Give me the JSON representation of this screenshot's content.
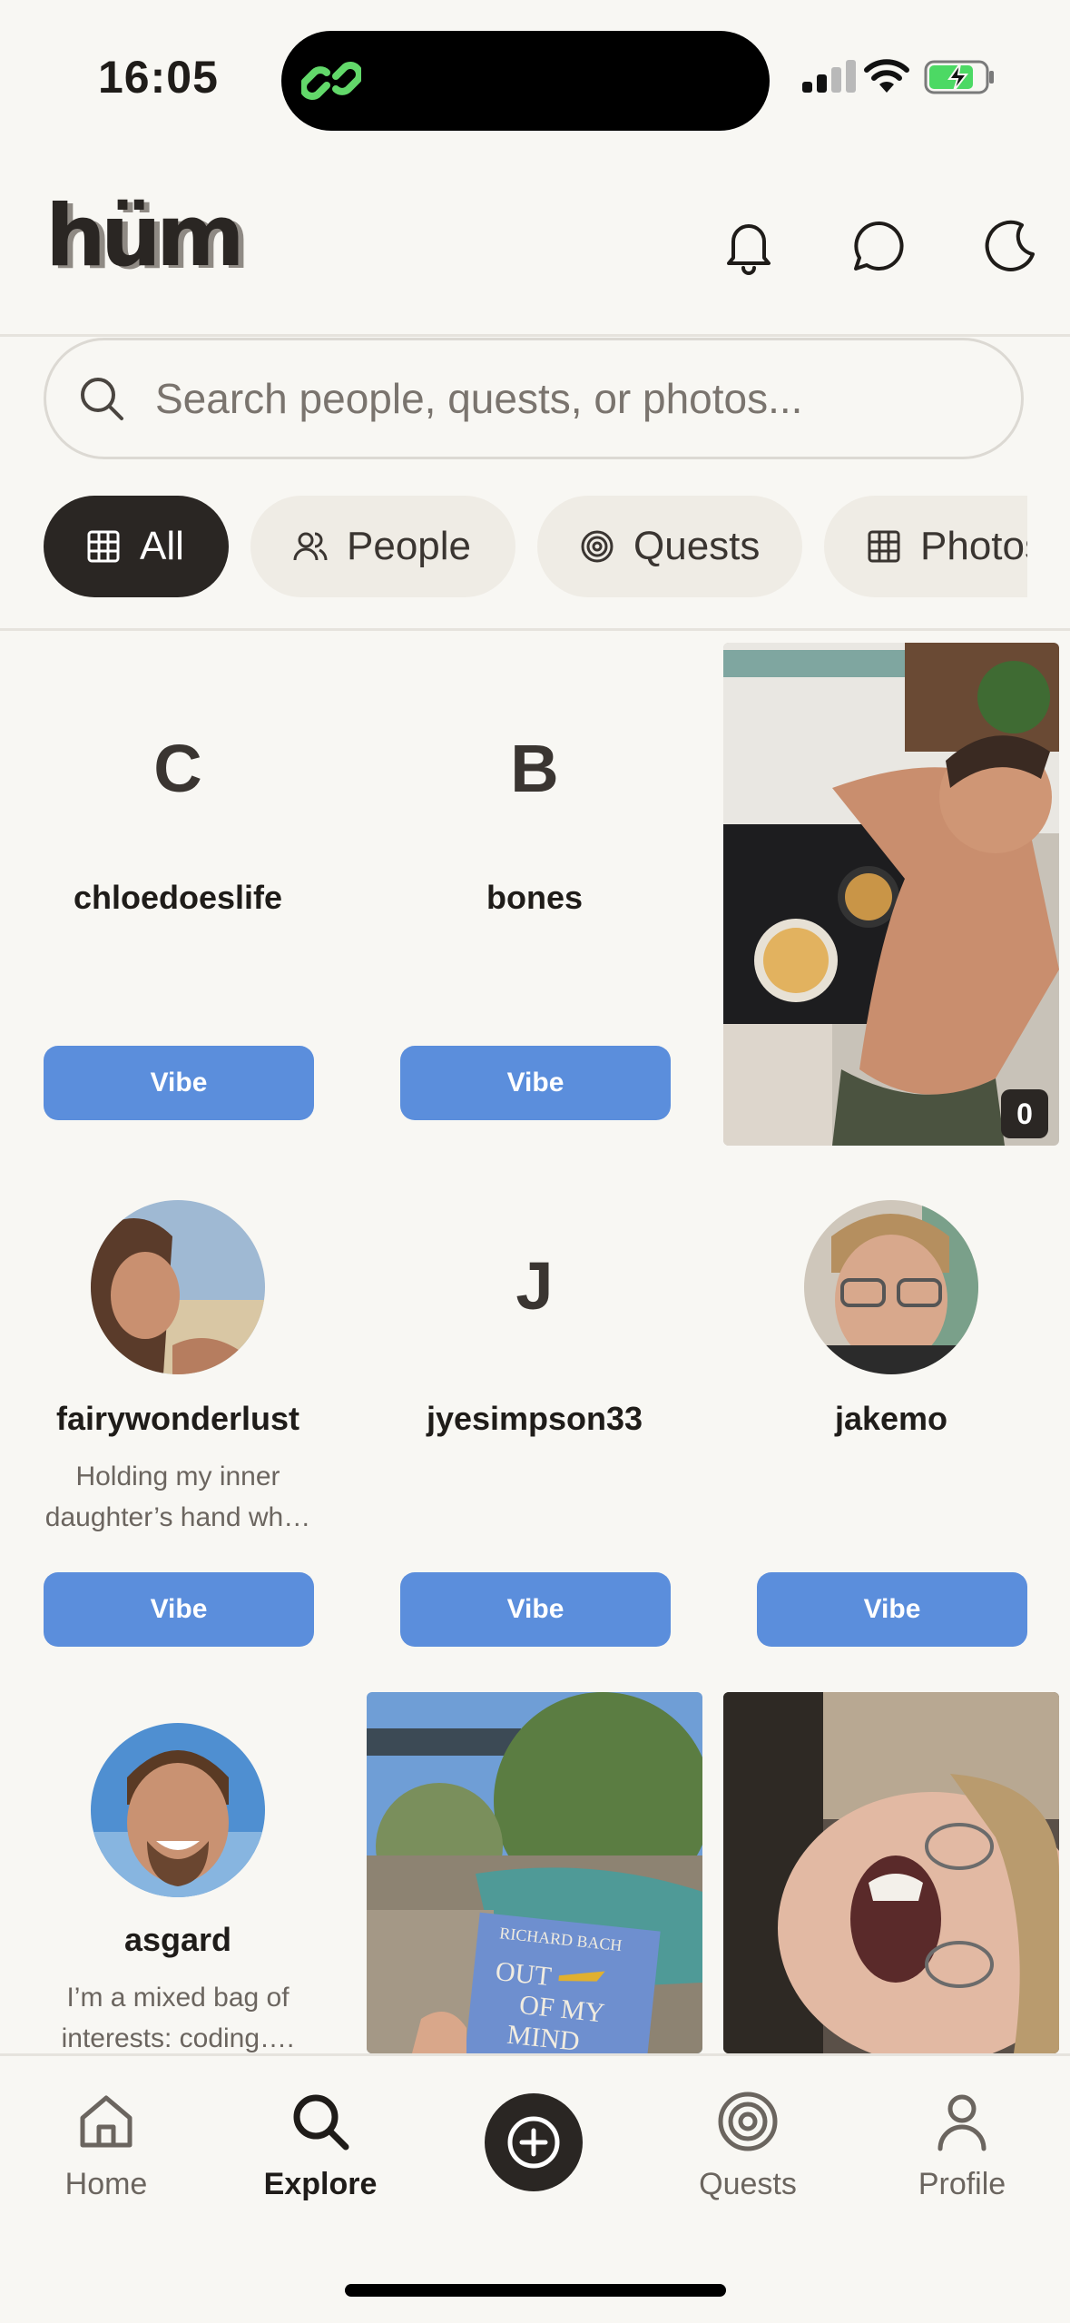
{
  "status_bar": {
    "time": "16:05"
  },
  "header": {
    "logo": "hüm",
    "icons": [
      "bell-icon",
      "chat-bubble-icon",
      "moon-icon"
    ]
  },
  "search": {
    "placeholder": "Search people, quests, or photos..."
  },
  "filters": {
    "chips": [
      {
        "label": "All",
        "icon": "grid-icon",
        "active": true
      },
      {
        "label": "People",
        "icon": "people-icon",
        "active": false
      },
      {
        "label": "Quests",
        "icon": "target-icon",
        "active": false
      },
      {
        "label": "Photos",
        "icon": "grid-icon",
        "active": false
      }
    ]
  },
  "grid": {
    "vibe_label": "Vibe",
    "people": [
      {
        "initial": "C",
        "username": "chloedoeslife",
        "bio": ""
      },
      {
        "initial": "B",
        "username": "bones",
        "bio": ""
      },
      {
        "username": "fairywonderlust",
        "bio": "Holding my inner daughter’s hand wh…"
      },
      {
        "initial": "J",
        "username": "jyesimpson33",
        "bio": ""
      },
      {
        "username": "jakemo",
        "bio": ""
      },
      {
        "username": "asgard",
        "bio": "I’m a mixed bag of interests: coding…."
      }
    ],
    "photos": [
      {
        "subject": "selfie at stove with pancakes",
        "count": "0"
      },
      {
        "subject": "book by pool",
        "book_author": "RICHARD BACH",
        "book_title_line1": "OUT",
        "book_title_line2": "OF MY",
        "book_title_line3": "MIND"
      },
      {
        "subject": "laughing selfie"
      }
    ]
  },
  "bottom_nav": {
    "items": [
      {
        "label": "Home",
        "icon": "home-icon",
        "active": false
      },
      {
        "label": "Explore",
        "icon": "search-icon",
        "active": true
      },
      {
        "label": "",
        "icon": "plus-circle-icon",
        "active": false
      },
      {
        "label": "Quests",
        "icon": "target-icon",
        "active": false
      },
      {
        "label": "Profile",
        "icon": "user-icon",
        "active": false
      }
    ]
  },
  "colors": {
    "accent": "#5b8edc",
    "dark": "#2a2623",
    "background": "#f8f7f3"
  }
}
